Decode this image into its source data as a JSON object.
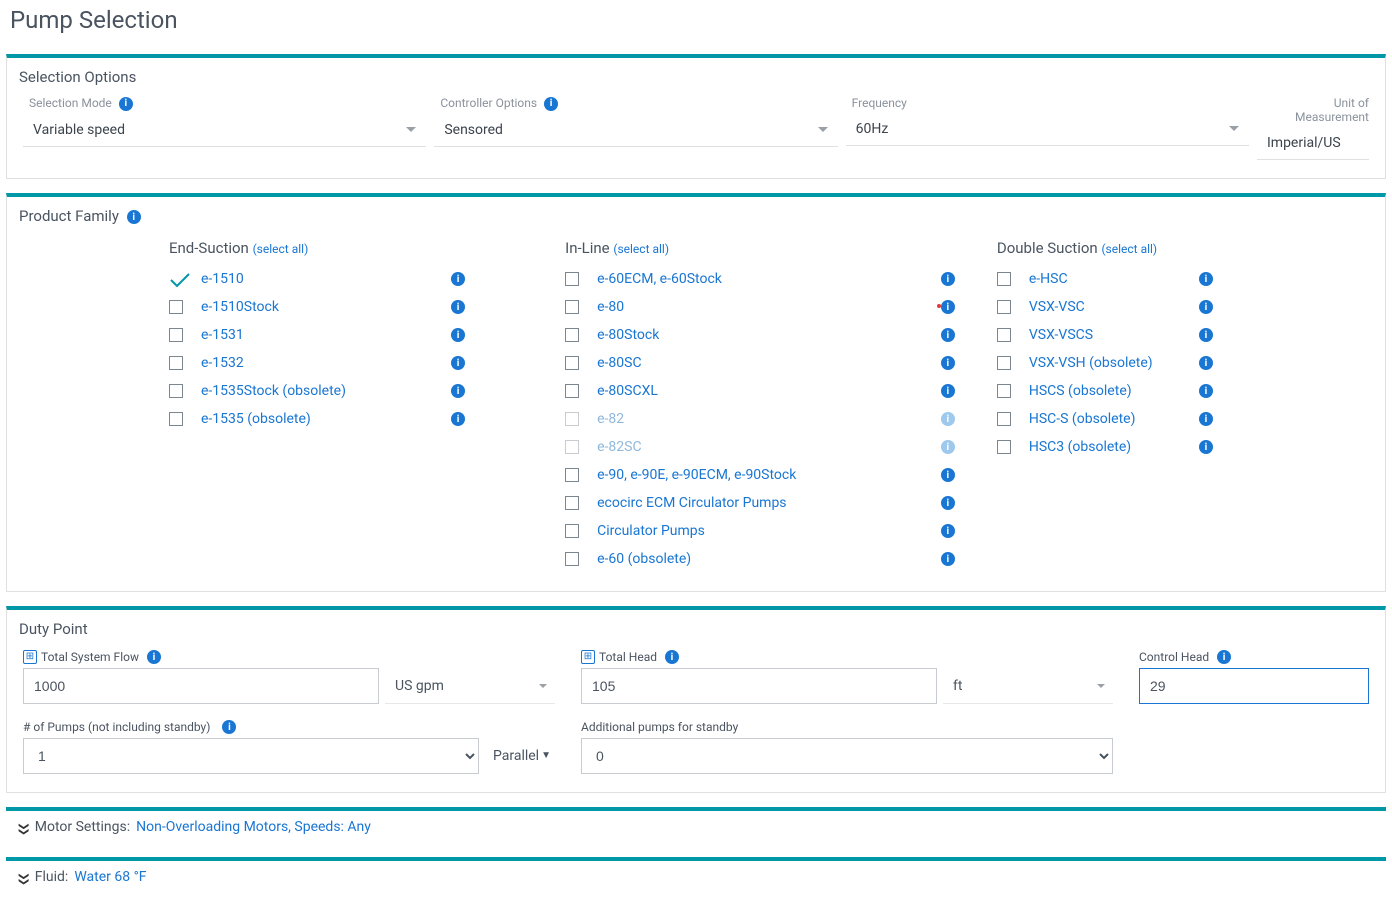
{
  "pageTitle": "Pump Selection",
  "selectionOptions": {
    "panelLabel": "Selection Options",
    "selectionMode": {
      "label": "Selection Mode",
      "value": "Variable speed"
    },
    "controllerOptions": {
      "label": "Controller Options",
      "value": "Sensored"
    },
    "frequency": {
      "label": "Frequency",
      "value": "60Hz"
    },
    "unitOfMeasurement": {
      "label": "Unit of Measurement",
      "value": "Imperial/US"
    }
  },
  "productFamily": {
    "panelLabel": "Product Family",
    "selectAllText": "(select all)",
    "columns": {
      "endSuction": {
        "title": "End-Suction",
        "items": [
          {
            "label": "e-1510",
            "checked": true
          },
          {
            "label": "e-1510Stock"
          },
          {
            "label": "e-1531"
          },
          {
            "label": "e-1532"
          },
          {
            "label": "e-1535Stock (obsolete)"
          },
          {
            "label": "e-1535 (obsolete)"
          }
        ]
      },
      "inLine": {
        "title": "In-Line",
        "items": [
          {
            "label": "e-60ECM, e-60Stock"
          },
          {
            "label": "e-80"
          },
          {
            "label": "e-80Stock"
          },
          {
            "label": "e-80SC"
          },
          {
            "label": "e-80SCXL"
          },
          {
            "label": "e-82",
            "disabled": true
          },
          {
            "label": "e-82SC",
            "disabled": true
          },
          {
            "label": "e-90, e-90E, e-90ECM, e-90Stock"
          },
          {
            "label": "ecocirc ECM Circulator Pumps"
          },
          {
            "label": "Circulator Pumps"
          },
          {
            "label": "e-60 (obsolete)"
          }
        ]
      },
      "doubleSuction": {
        "title": "Double Suction",
        "items": [
          {
            "label": "e-HSC"
          },
          {
            "label": "VSX-VSC"
          },
          {
            "label": "VSX-VSCS"
          },
          {
            "label": "VSX-VSH (obsolete)"
          },
          {
            "label": "HSCS (obsolete)"
          },
          {
            "label": "HSC-S (obsolete)"
          },
          {
            "label": "HSC3 (obsolete)"
          }
        ]
      }
    }
  },
  "dutyPoint": {
    "panelLabel": "Duty Point",
    "totalSystemFlow": {
      "label": "Total System Flow",
      "value": "1000",
      "unit": "US gpm"
    },
    "totalHead": {
      "label": "Total Head",
      "value": "105",
      "unit": "ft"
    },
    "controlHead": {
      "label": "Control Head",
      "value": "29"
    },
    "numPumps": {
      "label": "# of Pumps (not including standby)",
      "value": "1",
      "arrangement": "Parallel"
    },
    "additionalStandby": {
      "label": "Additional pumps for standby",
      "value": "0"
    }
  },
  "motorSettings": {
    "label": "Motor Settings:",
    "value": "Non-Overloading Motors, Speeds: Any"
  },
  "fluid": {
    "label": "Fluid:",
    "value": "Water 68 °F"
  }
}
